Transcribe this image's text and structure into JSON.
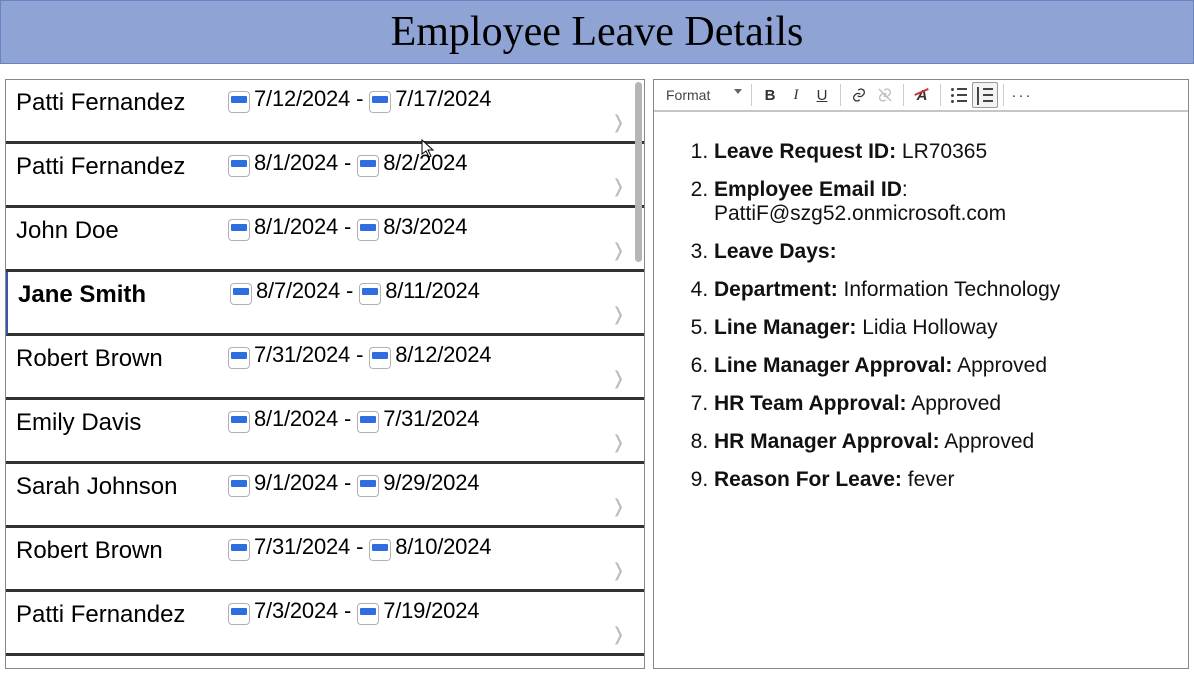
{
  "header": {
    "title": "Employee Leave Details"
  },
  "list": {
    "items": [
      {
        "name": "Patti Fernandez",
        "start": "7/12/2024",
        "end": "7/17/2024",
        "selected": false
      },
      {
        "name": "Patti Fernandez",
        "start": "8/1/2024",
        "end": "8/2/2024",
        "selected": false
      },
      {
        "name": "John Doe",
        "start": "8/1/2024",
        "end": "8/3/2024",
        "selected": false
      },
      {
        "name": "Jane Smith",
        "start": "8/7/2024",
        "end": "8/11/2024",
        "selected": true
      },
      {
        "name": "Robert Brown",
        "start": "7/31/2024",
        "end": "8/12/2024",
        "selected": false
      },
      {
        "name": "Emily Davis",
        "start": "8/1/2024",
        "end": "7/31/2024",
        "selected": false
      },
      {
        "name": "Sarah Johnson",
        "start": "9/1/2024",
        "end": "9/29/2024",
        "selected": false
      },
      {
        "name": "Robert Brown",
        "start": "7/31/2024",
        "end": "8/10/2024",
        "selected": false
      },
      {
        "name": "Patti Fernandez",
        "start": "7/3/2024",
        "end": "7/19/2024",
        "selected": false
      }
    ]
  },
  "toolbar": {
    "format_label": "Format",
    "bold": "B",
    "italic": "I",
    "underline": "U",
    "more": "···"
  },
  "details": {
    "fields": [
      {
        "label": "Leave Request ID:",
        "value": "LR70365"
      },
      {
        "label": "Employee Email ID",
        "colon": ":",
        "value": "PattiF@szg52.onmicrosoft.com",
        "break": true
      },
      {
        "label": "Leave Days:",
        "value": ""
      },
      {
        "label": "Department:",
        "value": "Information Technology"
      },
      {
        "label": "Line Manager:",
        "value": "Lidia Holloway"
      },
      {
        "label": "Line Manager Approval:",
        "value": "Approved"
      },
      {
        "label": "HR Team Approval:",
        "value": "Approved"
      },
      {
        "label": "HR Manager Approval:",
        "value": "Approved"
      },
      {
        "label": "Reason For Leave:",
        "value": "fever"
      }
    ]
  }
}
